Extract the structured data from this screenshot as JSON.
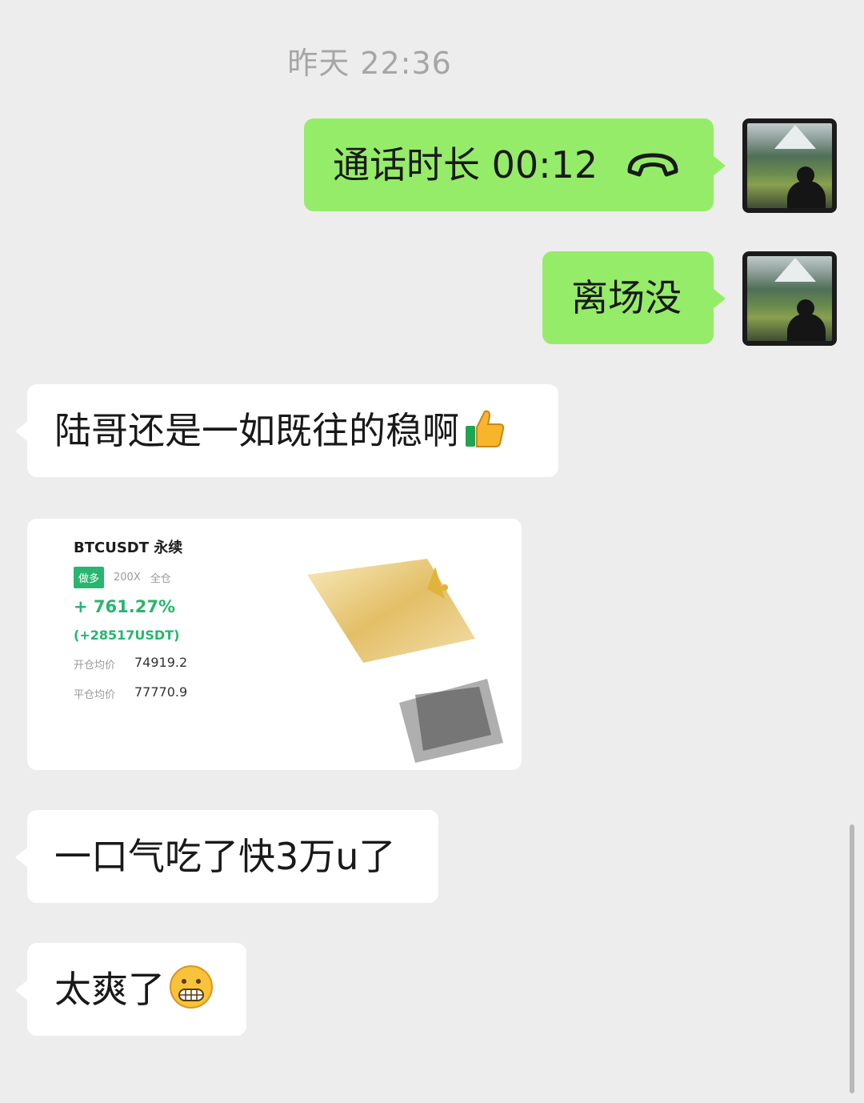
{
  "timestamp": "昨天  22:36",
  "messages": {
    "call": {
      "label": "通话时长 00:12",
      "icon": "phone-hangup-icon"
    },
    "out2": "离场没",
    "in1": {
      "text": "陆哥还是一如既往的稳啊",
      "emoji": "thumbs-up-icon"
    },
    "in2": "一口气吃了快3万u了",
    "in3": {
      "text": "太爽了",
      "emoji": "grimacing-face-icon"
    }
  },
  "trade_card": {
    "pair": "BTCUSDT 永续",
    "side": "做多",
    "leverage": "200X",
    "margin_mode": "全仓",
    "pnl_percent": "+ 761.27%",
    "pnl_amount": "(+28517USDT)",
    "open_label": "开仓均价",
    "open_price": "74919.2",
    "close_label": "平仓均价",
    "close_price": "77770.9"
  },
  "colors": {
    "background": "#ededed",
    "outgoing_bubble": "#95ec69",
    "incoming_bubble": "#ffffff",
    "profit_green": "#27b66f",
    "timestamp_text": "#a6a6a6"
  }
}
